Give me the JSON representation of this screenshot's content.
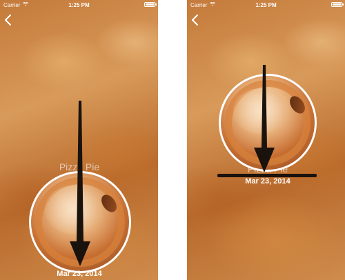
{
  "status_bar": {
    "carrier": "Carrier",
    "time": "1:25 PM"
  },
  "left_screen": {
    "title": "Pizza Pie",
    "date": "Mar 23, 2014"
  },
  "right_screen": {
    "title": "Pizza Pie",
    "date": "Mar 23, 2014"
  },
  "icons": {
    "back": "chevron-left-icon",
    "wifi": "wifi-icon",
    "battery": "battery-icon",
    "annotation": "arrow-down-icon"
  },
  "colors": {
    "background": "#d08a48",
    "text": "#ffffff",
    "annotation": "#1a120c"
  }
}
